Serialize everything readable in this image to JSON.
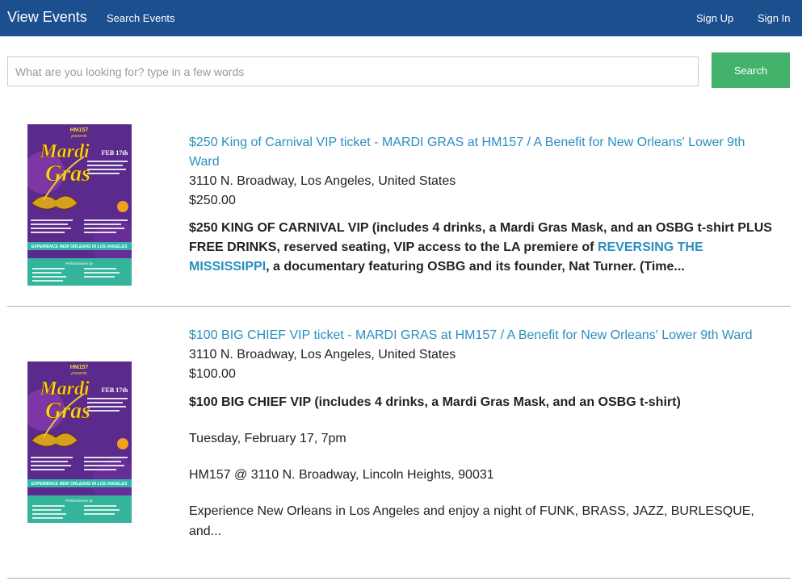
{
  "navbar": {
    "brand": "View Events",
    "search_events": "Search Events",
    "sign_up": "Sign Up",
    "sign_in": "Sign In"
  },
  "search": {
    "placeholder": "What are you looking for? type in a few words",
    "button_label": "Search"
  },
  "events": [
    {
      "title": "$250 King of Carnival VIP ticket - MARDI GRAS at HM157 / A Benefit for New Orleans' Lower 9th Ward",
      "address": "3110 N. Broadway, Los Angeles, United States",
      "price": "$250.00",
      "description_part1": "$250 KING OF CARNIVAL VIP (includes 4 drinks, a Mardi Gras Mask, and an OSBG t-shirt PLUS FREE DRINKS, reserved seating, VIP access to the LA premiere of ",
      "description_link": "REVERSING THE MISSISSIPPI",
      "description_part2": ", a documentary featuring OSBG and its founder, Nat Turner. (Time..."
    },
    {
      "title": "$100 BIG CHIEF VIP ticket - MARDI GRAS at HM157 / A Benefit for New Orleans' Lower 9th Ward",
      "address": "3110 N. Broadway, Los Angeles, United States",
      "price": "$100.00",
      "description": "$100 BIG CHIEF VIP (includes 4 drinks, a Mardi Gras Mask, and an OSBG t-shirt)",
      "date_line": "Tuesday, February 17, 7pm",
      "venue_line": "HM157 @ 3110 N. Broadway, Lincoln Heights, 90031",
      "blurb": "Experience New Orleans in Los Angeles and enjoy a night of FUNK, BRASS, JAZZ, BURLESQUE, and..."
    }
  ],
  "poster": {
    "top_small": "HM157",
    "presents": "presents",
    "word1": "Mardi",
    "word2": "Gras",
    "date_main": "FEB 17th",
    "banner": "EXPERIENCE NEW ORLEANS IN LOS ANGELES",
    "performances": "Performances by",
    "colors": {
      "bg": "#5a2a8c",
      "title": "#f6d42a",
      "banner": "#2fb6a8",
      "bottom": "#34b59b"
    }
  }
}
